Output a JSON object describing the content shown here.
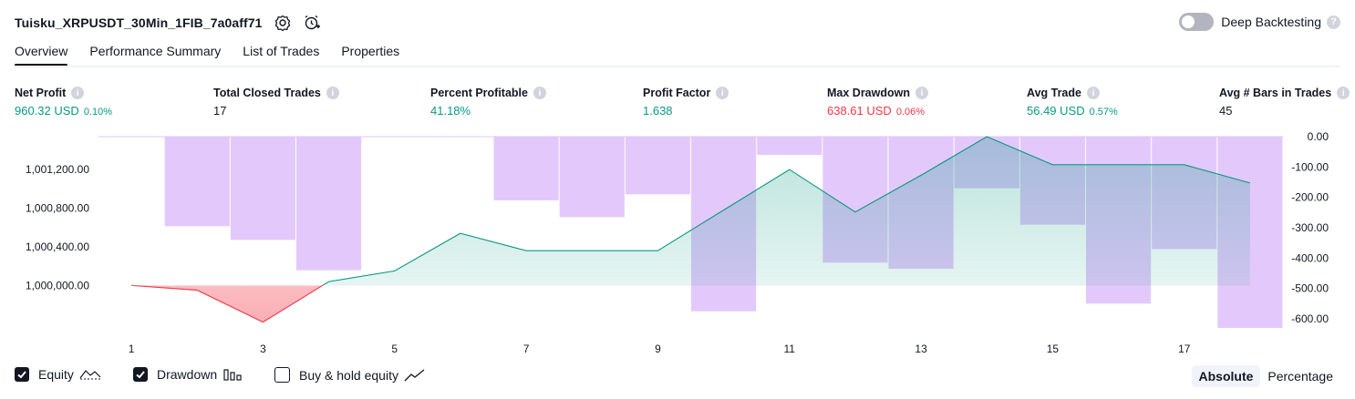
{
  "header": {
    "title": "Tuisku_XRPUSDT_30Min_1FIB_7a0aff71",
    "deep_backtesting_label": "Deep Backtesting",
    "deep_backtesting_on": false
  },
  "tabs": [
    {
      "label": "Overview",
      "active": true
    },
    {
      "label": "Performance Summary",
      "active": false
    },
    {
      "label": "List of Trades",
      "active": false
    },
    {
      "label": "Properties",
      "active": false
    }
  ],
  "metrics": [
    {
      "label": "Net Profit",
      "value": "960.32 USD",
      "pct": "0.10%",
      "color": "#089981"
    },
    {
      "label": "Total Closed Trades",
      "value": "17",
      "pct": "",
      "color": "#131722"
    },
    {
      "label": "Percent Profitable",
      "value": "41.18%",
      "pct": "",
      "color": "#089981"
    },
    {
      "label": "Profit Factor",
      "value": "1.638",
      "pct": "",
      "color": "#089981"
    },
    {
      "label": "Max Drawdown",
      "value": "638.61 USD",
      "pct": "0.06%",
      "color": "#f23645"
    },
    {
      "label": "Avg Trade",
      "value": "56.49 USD",
      "pct": "0.57%",
      "color": "#089981"
    },
    {
      "label": "Avg # Bars in Trades",
      "value": "45",
      "pct": "",
      "color": "#131722"
    }
  ],
  "chart_data": {
    "type": "line",
    "x_ticks": [
      "1",
      "3",
      "5",
      "7",
      "9",
      "11",
      "13",
      "15",
      "17"
    ],
    "equity": {
      "name": "Equity",
      "x": [
        1,
        2,
        3,
        4,
        5,
        6,
        7,
        8,
        9,
        10,
        11,
        12,
        13,
        14,
        15,
        16,
        17,
        18
      ],
      "y": [
        1000000,
        999950,
        999620,
        1000040,
        1000150,
        1000540,
        1000360,
        1000360,
        1000360,
        1000780,
        1001200,
        1000760,
        1001140,
        1001540,
        1001250,
        1001250,
        1001250,
        1001060
      ],
      "baseline": 1000000,
      "left_ticks": [
        1000000,
        1000400,
        1000800,
        1001200
      ],
      "left_tick_labels": [
        "1,000,000.00",
        "1,000,400.00",
        "1,000,800.00",
        "1,001,200.00"
      ],
      "left_range": [
        999560,
        1001540
      ],
      "above_color": "#089981",
      "below_color": "#f23645"
    },
    "drawdown": {
      "name": "Drawdown",
      "x": [
        1,
        2,
        3,
        4,
        5,
        6,
        7,
        8,
        9,
        10,
        11,
        12,
        13,
        14,
        15,
        16,
        17,
        18
      ],
      "y": [
        0,
        -295,
        -340,
        -440,
        0,
        0,
        -210,
        -265,
        -190,
        -575,
        -60,
        -415,
        -435,
        -170,
        -290,
        -550,
        -370,
        -630
      ],
      "right_ticks": [
        0,
        -100,
        -200,
        -300,
        -400,
        -500,
        -600
      ],
      "right_tick_labels": [
        "0.00",
        "-100.00",
        "-200.00",
        "-300.00",
        "-400.00",
        "-500.00",
        "-600.00"
      ],
      "right_range": [
        -630,
        0
      ],
      "color": "#e1c4fb"
    }
  },
  "legend": {
    "equity_label": "Equity",
    "equity_checked": true,
    "drawdown_label": "Drawdown",
    "drawdown_checked": true,
    "buyhold_label": "Buy & hold equity",
    "buyhold_checked": false
  },
  "scale": {
    "absolute_label": "Absolute",
    "percentage_label": "Percentage",
    "selected": "Absolute"
  }
}
